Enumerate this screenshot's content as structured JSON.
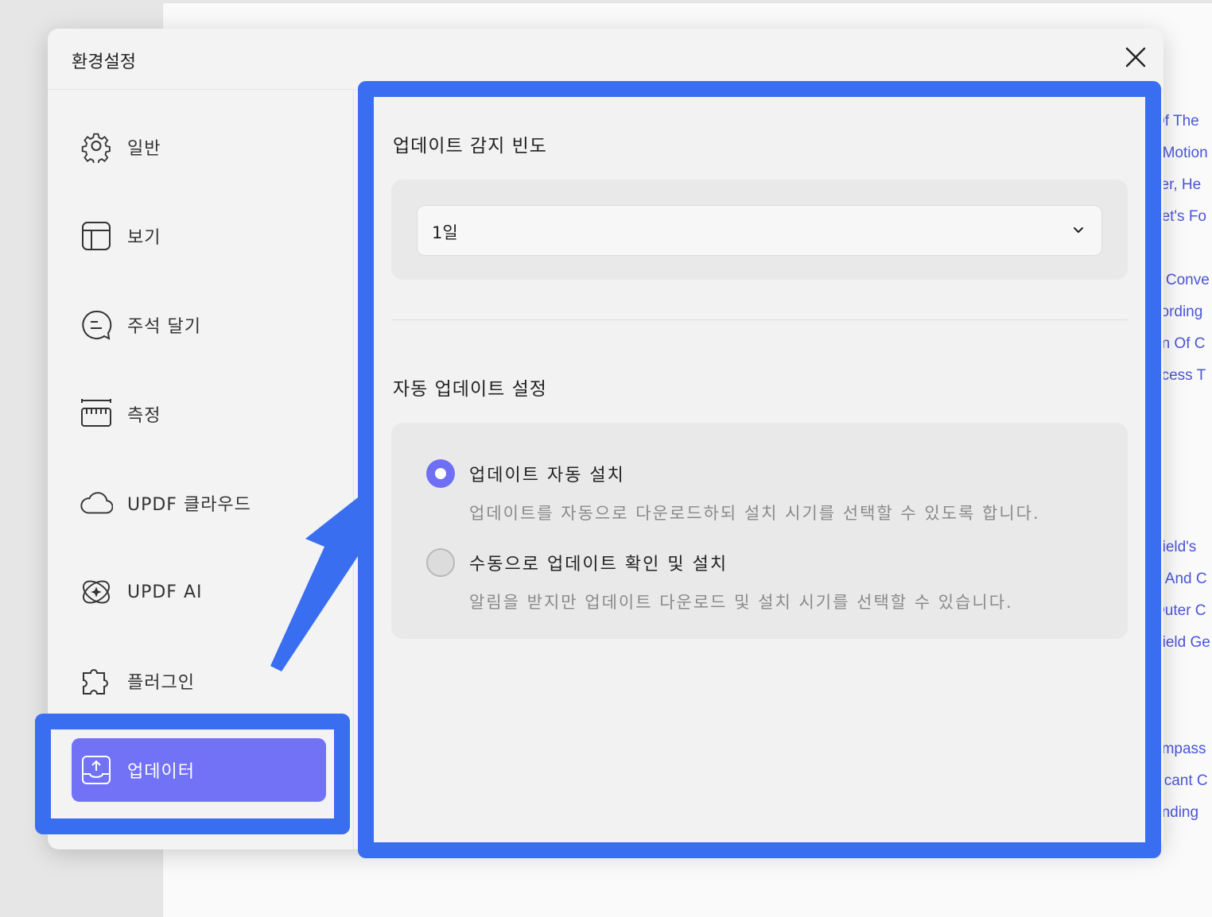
{
  "background_doc": {
    "lines": [
      "Of The",
      "· Motion",
      "yer, He",
      "het's Fo",
      "e Conve",
      "cording",
      "on Of C",
      "ocess T",
      "Field's",
      "n And C",
      "Outer C",
      "Field Ge",
      "ompass",
      "ificant C",
      "anding"
    ]
  },
  "dialog": {
    "title": "환경설정",
    "close_icon": "close-icon"
  },
  "sidebar": {
    "items": [
      {
        "label": "일반",
        "icon": "gear-icon"
      },
      {
        "label": "보기",
        "icon": "layout-icon"
      },
      {
        "label": "주석 달기",
        "icon": "comment-icon"
      },
      {
        "label": "측정",
        "icon": "ruler-icon"
      },
      {
        "label": "UPDF 클라우드",
        "icon": "cloud-icon"
      },
      {
        "label": "UPDF AI",
        "icon": "ai-sparkle-icon"
      },
      {
        "label": "플러그인",
        "icon": "puzzle-icon"
      },
      {
        "label": "업데이터",
        "icon": "upload-tray-icon",
        "active": true
      }
    ]
  },
  "content": {
    "frequency": {
      "title": "업데이트 감지 빈도",
      "selected": "1일"
    },
    "auto_update": {
      "title": "자동 업데이트 설정",
      "options": [
        {
          "label": "업데이트 자동 설치",
          "description": "업데이트를 자동으로 다운로드하되 설치 시기를 선택할 수 있도록 합니다.",
          "selected": true
        },
        {
          "label": "수동으로 업데이트 확인 및 설치",
          "description": "알림을 받지만 업데이트 다운로드 및 설치 시기를 선택할 수 있습니다.",
          "selected": false
        }
      ]
    }
  },
  "colors": {
    "accent": "#7272f7",
    "highlight": "#3a6ef0",
    "link_text": "#4a55d8"
  }
}
